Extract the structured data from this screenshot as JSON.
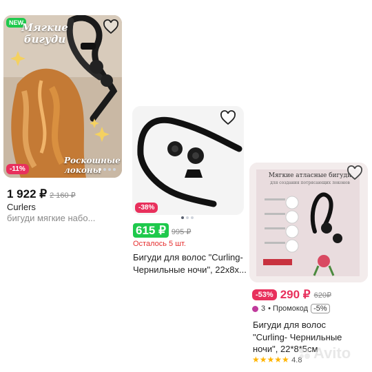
{
  "card1": {
    "badge_new": "NEW",
    "title_overlay": "Мягкие бигуди",
    "caption_overlay": "Роскошные локоны",
    "discount": "-11%",
    "price": "1 922 ₽",
    "old_price": "2 160 ₽",
    "name": "Curlers",
    "subtitle": "бигуди мягкие набо..."
  },
  "card2": {
    "discount": "-38%",
    "price": "615 ₽",
    "old_price": "995 ₽",
    "stock": "Осталось 5 шт.",
    "name_line1": "Бигуди для волос \"Curling-",
    "name_line2": "Чернильные ночи\", 22x8x..."
  },
  "card3": {
    "image_title": "Мягкие атласные бигуди",
    "image_subtitle": "для создания потрясающих локонов",
    "discount": "-53%",
    "price": "290 ₽",
    "old_price": "620₽",
    "promo_count": "3",
    "promo_label": "• Промокод",
    "promo_value": "-5%",
    "name_line1": "Бигуди для волос",
    "name_line2": "\"Curling- Чернильные",
    "name_line3": "ночи\", 22*8*5см",
    "rating": "4.8"
  },
  "watermark": "Avito",
  "colors": {
    "accent_green": "#1ec94c",
    "discount_red": "#e8305c",
    "price_red": "#e8305c",
    "stock_red": "#e52e2e",
    "star": "#ffb400"
  }
}
